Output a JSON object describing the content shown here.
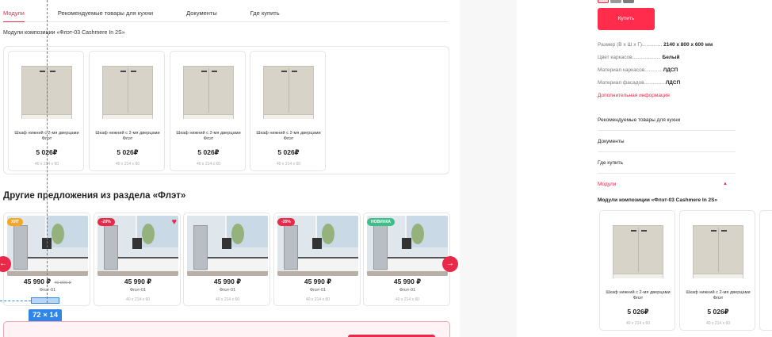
{
  "tabs": [
    {
      "label": "Модули",
      "active": true
    },
    {
      "label": "Рекомендуемые товары для кухни",
      "active": false
    },
    {
      "label": "Документы",
      "active": false
    },
    {
      "label": "Где купить",
      "active": false
    }
  ],
  "modules_title": "Модули композиции «Флэт-03 Cashmere In 2S»",
  "modules": [
    {
      "name": "Шкаф нижний с 2-мя дверцами Флэт",
      "price": "5 026₽",
      "dims": "40 x 214 x 60"
    },
    {
      "name": "Шкаф нижний с 2-мя дверцами Флэт",
      "price": "5 026₽",
      "dims": "40 x 214 x 60"
    },
    {
      "name": "Шкаф нижний с 2-мя дверцами Флэт",
      "price": "5 026₽",
      "dims": "40 x 214 x 60"
    },
    {
      "name": "Шкаф нижний с 2-мя дверцами Флэт",
      "price": "5 026₽",
      "dims": "40 x 214 x 60"
    }
  ],
  "offers_title": "Другие предложения из раздела «Флэт»",
  "offers": [
    {
      "badge": "ХИТ",
      "badge_type": "hit",
      "price": "45 990 ₽",
      "old_price": "46 990 ₽",
      "name": "Флэт-01",
      "dims": "40 x 214 x 60",
      "heart": false
    },
    {
      "badge": "-20%",
      "badge_type": "sale",
      "price": "45 990 ₽",
      "old_price": "",
      "name": "Флэт-01",
      "dims": "40 x 214 x 60",
      "heart": true
    },
    {
      "badge": "",
      "badge_type": "",
      "price": "45 990 ₽",
      "old_price": "",
      "name": "Флэт-01",
      "dims": "40 x 214 x 60",
      "heart": false
    },
    {
      "badge": "-35%",
      "badge_type": "sale",
      "price": "45 990 ₽",
      "old_price": "",
      "name": "Флэт-01",
      "dims": "40 x 214 x 60",
      "heart": false
    },
    {
      "badge": "НОВИНКА",
      "badge_type": "new",
      "price": "45 990 ₽",
      "old_price": "",
      "name": "Флэт-01",
      "dims": "40 x 214 x 60",
      "heart": false
    }
  ],
  "measure_label": "72 × 14",
  "arrows": {
    "prev": "←",
    "next": "→"
  },
  "colors": {
    "accent": "#e8294a",
    "guide": "#2f86e8"
  },
  "right": {
    "buy_label": "Купить",
    "specs": [
      {
        "label": "Размер (В x Ш x Г)..............",
        "value": "2140 x 800 x 600 мм"
      },
      {
        "label": "Цвет каркасов....................",
        "value": "Белый"
      },
      {
        "label": "Материал каркасов............",
        "value": "ЛДСП"
      },
      {
        "label": "Материал фасадов..............",
        "value": "ЛДСП"
      }
    ],
    "more_info": "Дополнительная информация",
    "accordion": [
      {
        "label": "Рекомендуемые товары для кухни",
        "active": false
      },
      {
        "label": "Документы",
        "active": false
      },
      {
        "label": "Где купить",
        "active": false
      },
      {
        "label": "Модули",
        "active": true
      }
    ],
    "modules_title": "Модули композиции «Флэт-03 Cashmere In 2S»",
    "modules": [
      {
        "name": "Шкаф нижний с 2-мя дверцами Флэт",
        "price": "5 026₽",
        "dims": "40 x 214 x 60"
      },
      {
        "name": "Шкаф нижний с 2-мя дверцами Флэт",
        "price": "5 026₽",
        "dims": "40 x 214 x 60"
      }
    ]
  }
}
